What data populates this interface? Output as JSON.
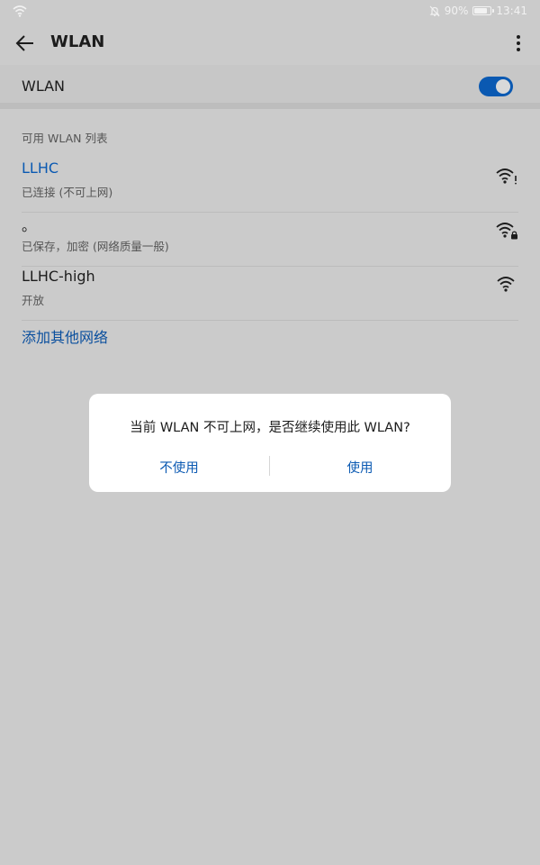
{
  "status_bar": {
    "battery": "90%",
    "battery_level": 0.9,
    "time": "13:41",
    "icons": [
      "wifi-icon",
      "bell-off-icon",
      "battery-icon"
    ]
  },
  "app_bar": {
    "title": "WLAN",
    "icons": [
      "back-arrow-icon",
      "more-vertical-icon"
    ]
  },
  "wlan_toggle": {
    "label": "WLAN",
    "enabled": true
  },
  "list": {
    "header": "可用 WLAN 列表",
    "networks": [
      {
        "name": "LLHC",
        "status": "已连接 (不可上网)",
        "icon": "wifi-warning-icon",
        "connected": true
      },
      {
        "name": "。",
        "status": "已保存，加密 (网络质量一般)",
        "icon": "wifi-locked-icon",
        "connected": false
      },
      {
        "name": "LLHC-high",
        "status": "开放",
        "icon": "wifi-icon",
        "connected": false
      }
    ],
    "add_network": "添加其他网络"
  },
  "dialog": {
    "message": "当前 WLAN 不可上网，是否继续使用此 WLAN?",
    "negative_button": "不使用",
    "positive_button": "使用"
  },
  "colors": {
    "accent": "#0a59b2",
    "background": "#cbcbcb",
    "dialog_bg": "#ffffff"
  }
}
